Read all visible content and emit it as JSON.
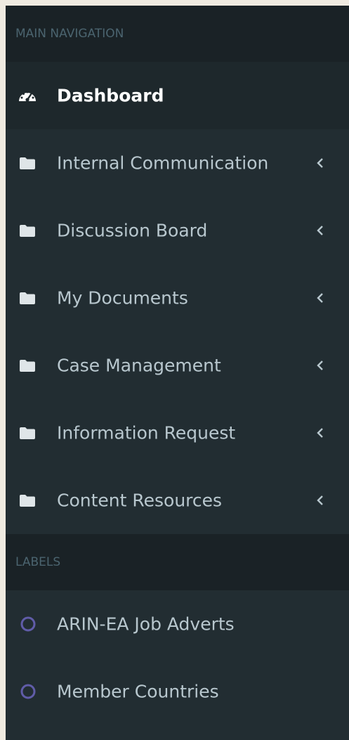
{
  "sidebar": {
    "main_header": "MAIN NAVIGATION",
    "items": [
      {
        "label": "Dashboard",
        "icon": "dashboard-icon"
      },
      {
        "label": "Internal Communication",
        "icon": "folder-icon"
      },
      {
        "label": "Discussion Board",
        "icon": "folder-icon"
      },
      {
        "label": "My Documents",
        "icon": "folder-icon"
      },
      {
        "label": "Case Management",
        "icon": "folder-icon"
      },
      {
        "label": "Information Request",
        "icon": "folder-icon"
      },
      {
        "label": "Content Resources",
        "icon": "folder-icon"
      }
    ],
    "labels_header": "LABELS",
    "labels": [
      {
        "label": "ARIN-EA Job Adverts",
        "icon": "circle-outline-icon"
      },
      {
        "label": "Member Countries",
        "icon": "circle-outline-icon"
      }
    ]
  },
  "colors": {
    "sidebar_bg": "#222d32",
    "header_bg": "#1a2226",
    "active_bg": "#1e282c",
    "text": "#b8c7ce",
    "active_text": "#ffffff",
    "header_text": "#4b646f",
    "label_circle": "#605ca8"
  }
}
